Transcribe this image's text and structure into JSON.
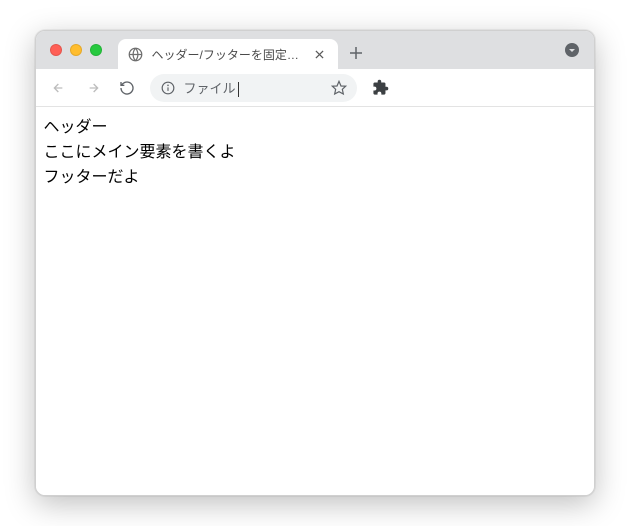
{
  "tab": {
    "title": "ヘッダー/フッターを固定する"
  },
  "addressbar": {
    "text": "ファイル"
  },
  "page": {
    "header_text": "ヘッダー",
    "main_text": "ここにメイン要素を書くよ",
    "footer_text": "フッターだよ"
  }
}
